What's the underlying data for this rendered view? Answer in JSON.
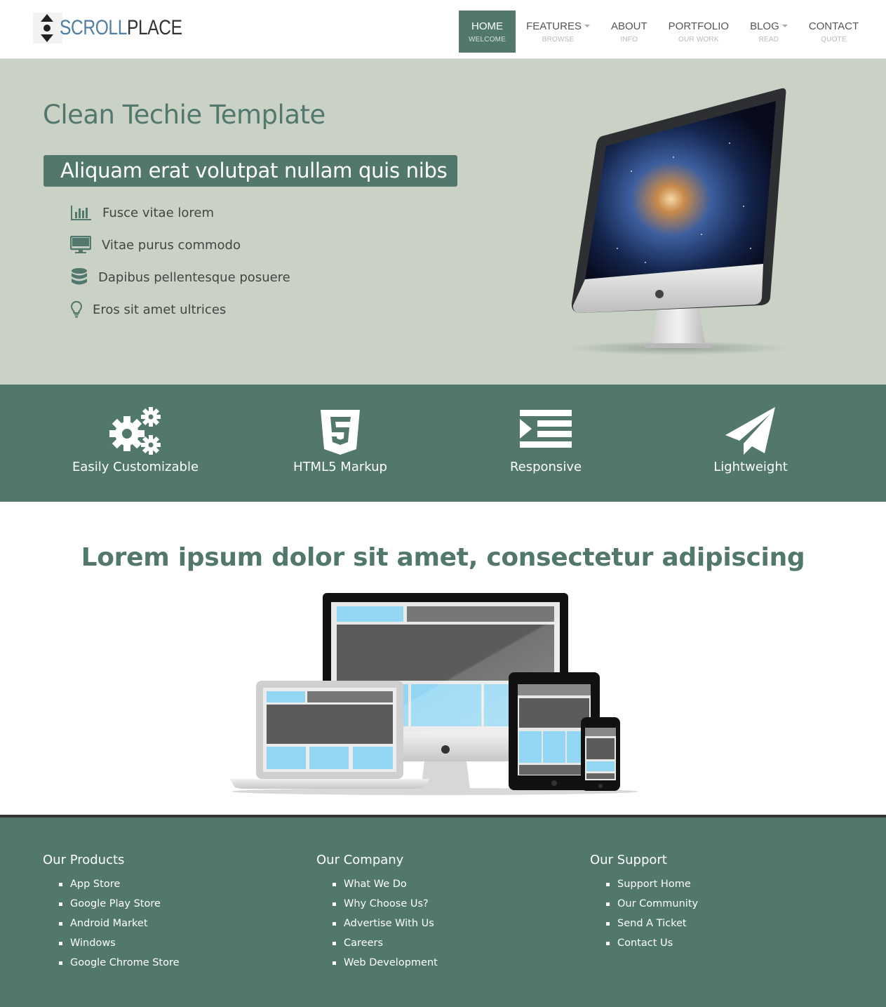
{
  "brand": {
    "part1": "SCROLL",
    "part2": "PLACE"
  },
  "nav": {
    "items": [
      {
        "label": "HOME",
        "sub": "WELCOME",
        "active": true,
        "dropdown": false
      },
      {
        "label": "FEATURES",
        "sub": "BROWSE",
        "active": false,
        "dropdown": true
      },
      {
        "label": "ABOUT",
        "sub": "INFO",
        "active": false,
        "dropdown": false
      },
      {
        "label": "PORTFOLIO",
        "sub": "OUR WORK",
        "active": false,
        "dropdown": false
      },
      {
        "label": "BLOG",
        "sub": "READ",
        "active": false,
        "dropdown": true
      },
      {
        "label": "CONTACT",
        "sub": "QUOTE",
        "active": false,
        "dropdown": false
      }
    ]
  },
  "hero": {
    "title": "Clean Techie Template",
    "banner": "Aliquam erat volutpat nullam quis nibs",
    "list": [
      {
        "text": "Fusce vitae lorem",
        "icon": "bar-chart-icon"
      },
      {
        "text": "Vitae purus commodo",
        "icon": "desktop-icon"
      },
      {
        "text": "Dapibus pellentesque posuere",
        "icon": "database-icon"
      },
      {
        "text": "Eros sit amet ultrices",
        "icon": "lightbulb-icon"
      }
    ]
  },
  "features": [
    {
      "label": "Easily Customizable",
      "icon": "gears-icon"
    },
    {
      "label": "HTML5 Markup",
      "icon": "html5-icon"
    },
    {
      "label": "Responsive",
      "icon": "indent-icon"
    },
    {
      "label": "Lightweight",
      "icon": "paper-plane-icon"
    }
  ],
  "section": {
    "title": "Lorem ipsum dolor sit amet, consectetur adipiscing"
  },
  "footer": {
    "columns": [
      {
        "title": "Our Products",
        "links": [
          "App Store",
          "Google Play Store",
          "Android Market",
          "Windows",
          "Google Chrome Store"
        ]
      },
      {
        "title": "Our Company",
        "links": [
          "What We Do",
          "Why Choose Us?",
          "Advertise With Us",
          "Careers",
          "Web Development"
        ]
      },
      {
        "title": "Our Support",
        "links": [
          "Support Home",
          "Our Community",
          "Send A Ticket",
          "Contact Us"
        ]
      }
    ]
  },
  "colors": {
    "accent": "#52776d",
    "hero_bg": "#cad2c6",
    "logo_blue": "#4f7ea7"
  }
}
